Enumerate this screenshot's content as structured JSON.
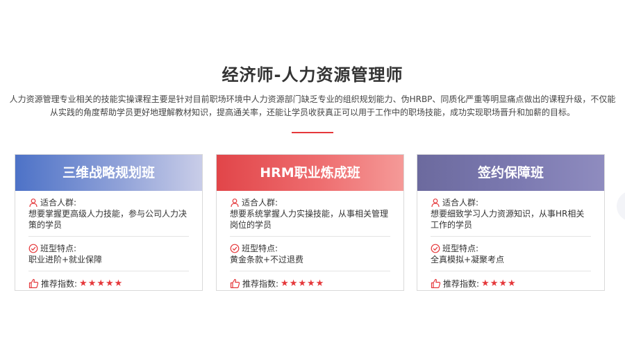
{
  "section": {
    "title": "经济师-人力资源管理师",
    "intro": "人力资源管理专业相关的技能实操课程主要是针对目前职场环境中人力资源部门缺乏专业的组织规划能力、伪HRBP、同质化严重等明显痛点做出的课程升级，不仅能从实践的角度帮助学员更好地理解教材知识，提高通关率，还能让学员收获真正可以用于工作中的职场技能，成功实现职场晋升和加薪的目标。"
  },
  "colors": {
    "accent": "#e5383b",
    "card1": "#4d72c7",
    "card2": "#e14549",
    "card3": "#6c6a9e"
  },
  "labels": {
    "audience": "适合人群:",
    "features": "班型特点:",
    "rating": "推荐指数:"
  },
  "icons": {
    "audience": "user-icon",
    "features": "check-circle-icon",
    "rating": "thumbs-up-icon"
  },
  "cards": [
    {
      "title": "三维战略规划班",
      "audience": "想要掌握更高级人力技能，参与公司人力决策的学员",
      "features": "职业进阶+就业保障",
      "stars": "★★★★★"
    },
    {
      "title": "HRM职业炼成班",
      "audience": "想要系统掌握人力实操技能，从事相关管理岗位的学员",
      "features": "黄金条款+不过退费",
      "stars": "★★★★★"
    },
    {
      "title": "签约保障班",
      "audience": "想要细致学习人力资源知识，从事HR相关工作的学员",
      "features": "全真模拟+凝聚考点",
      "stars": "★★★★"
    }
  ]
}
